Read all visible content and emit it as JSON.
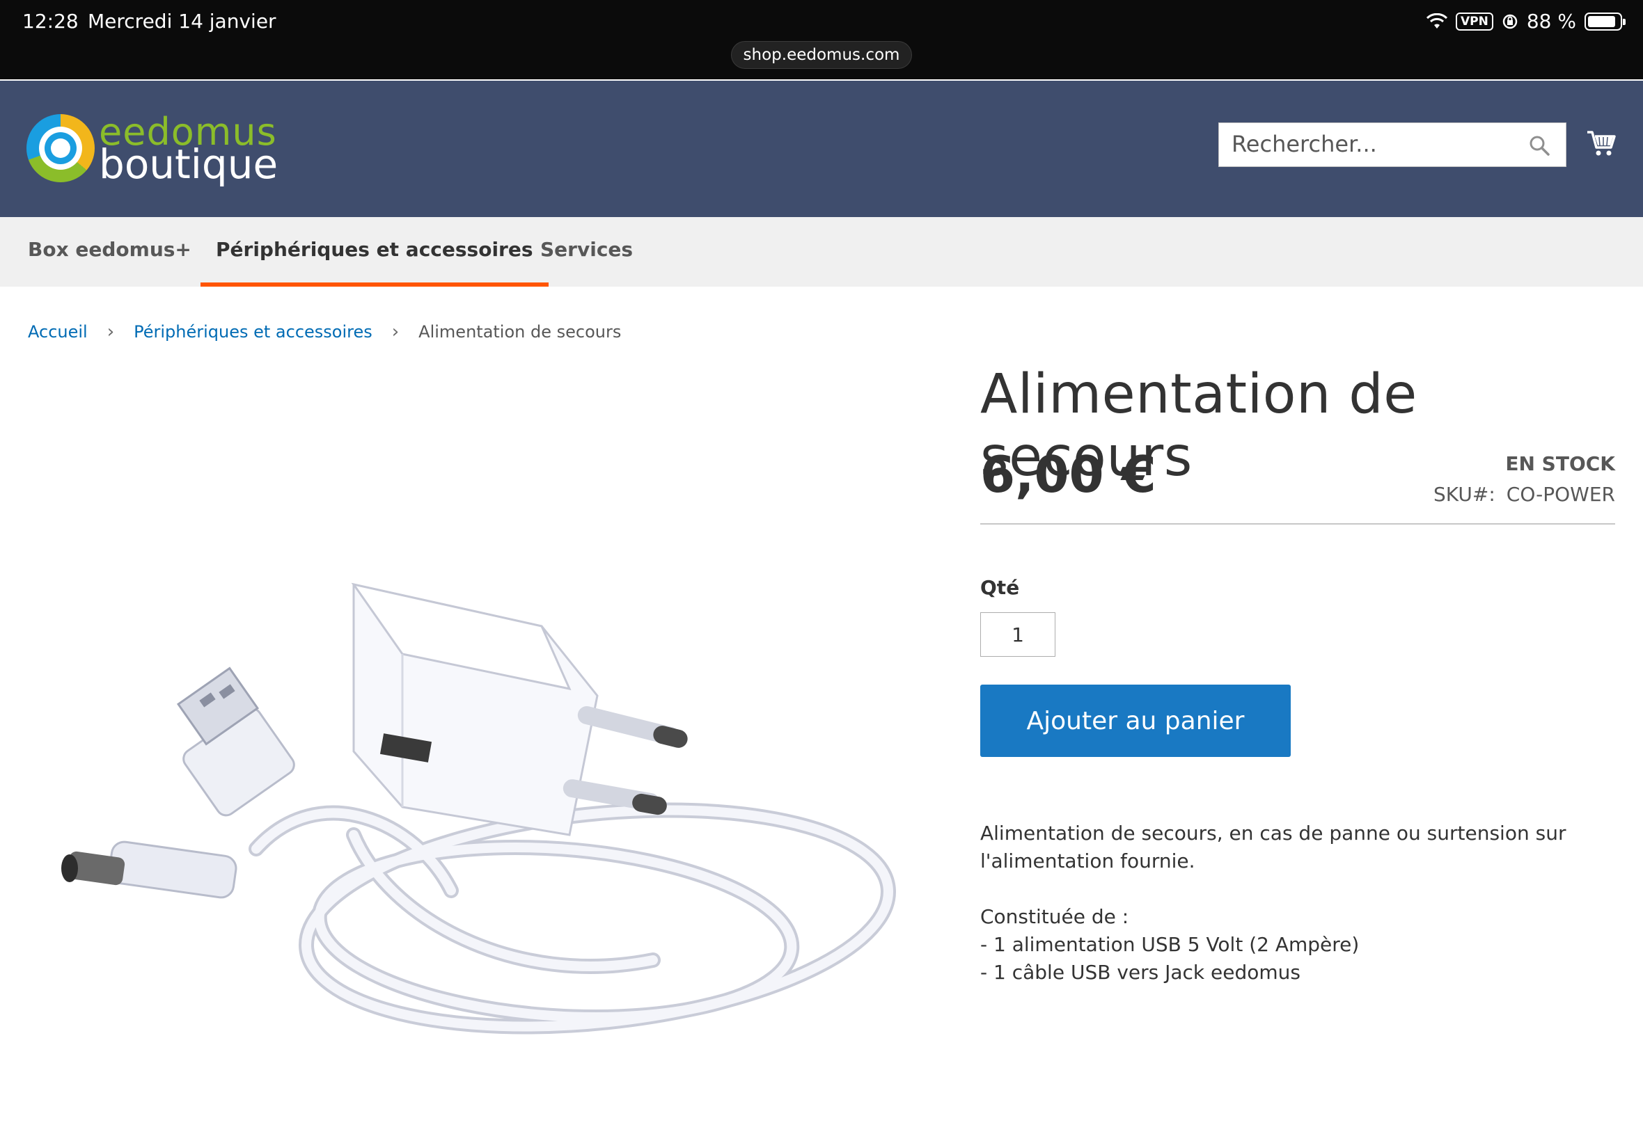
{
  "status_bar": {
    "time": "12:28",
    "date": "Mercredi 14 janvier",
    "vpn": "VPN",
    "battery": "88 %",
    "url": "shop.eedomus.com"
  },
  "header": {
    "logo_top": "eedomus",
    "logo_bottom": "boutique",
    "search_placeholder": "Rechercher..."
  },
  "nav": {
    "items": [
      {
        "label": "Box eedomus+"
      },
      {
        "label": "Périphériques et accessoires"
      },
      {
        "label": "Services"
      }
    ],
    "active_color": "#ff5501"
  },
  "breadcrumb": {
    "items": [
      "Accueil",
      "Périphériques et accessoires"
    ],
    "current": "Alimentation de secours"
  },
  "product": {
    "title": "Alimentation de secours",
    "price": "6,00 €",
    "stock": "EN STOCK",
    "sku_label": "SKU#:",
    "sku": "CO-POWER",
    "qty_label": "Qté",
    "qty_value": "1",
    "add_to_cart": "Ajouter au panier",
    "description": {
      "intro": "Alimentation de secours, en cas de panne ou surtension sur l'alimentation fournie.",
      "heading": "Constituée de :",
      "items": [
        "- 1 alimentation USB 5 Volt (2 Ampère)",
        "- 1 câble USB vers Jack eedomus"
      ]
    }
  },
  "colors": {
    "header_bg": "#3f4d6d",
    "button_bg": "#1979c3",
    "link": "#006bb4"
  }
}
